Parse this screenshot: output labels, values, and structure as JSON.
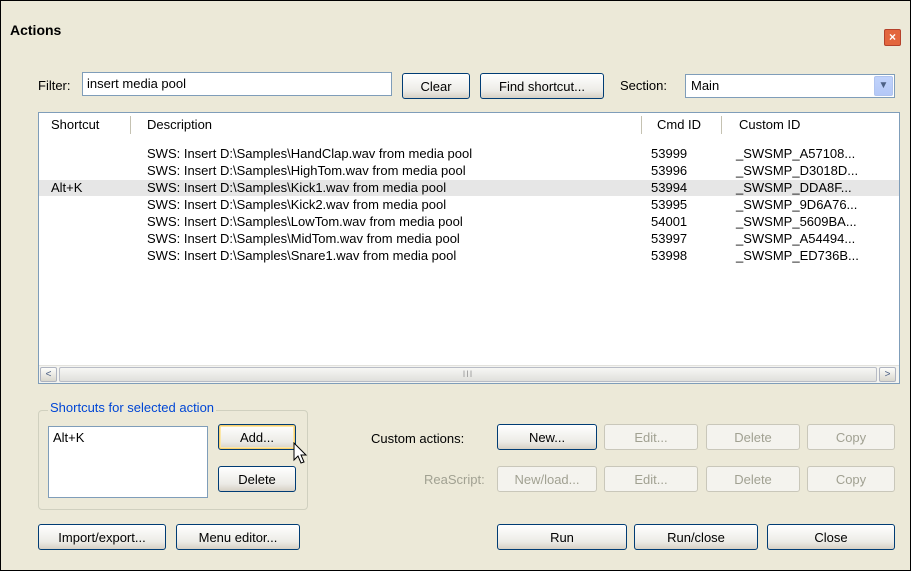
{
  "window": {
    "title": "Actions",
    "close_glyph": "×"
  },
  "filter": {
    "label": "Filter:",
    "value": "insert media pool",
    "clear_label": "Clear",
    "find_shortcut_label": "Find shortcut..."
  },
  "section": {
    "label": "Section:",
    "value": "Main"
  },
  "table": {
    "columns": [
      "Shortcut",
      "Description",
      "Cmd ID",
      "Custom ID"
    ],
    "rows": [
      {
        "shortcut": "",
        "description": "SWS: Insert D:\\Samples\\HandClap.wav from media pool",
        "cmd_id": "53999",
        "custom_id": "_SWSMP_A57108..."
      },
      {
        "shortcut": "",
        "description": "SWS: Insert D:\\Samples\\HighTom.wav from media pool",
        "cmd_id": "53996",
        "custom_id": "_SWSMP_D3018D..."
      },
      {
        "shortcut": "Alt+K",
        "description": "SWS: Insert D:\\Samples\\Kick1.wav from media pool",
        "cmd_id": "53994",
        "custom_id": "_SWSMP_DDA8F..."
      },
      {
        "shortcut": "",
        "description": "SWS: Insert D:\\Samples\\Kick2.wav from media pool",
        "cmd_id": "53995",
        "custom_id": "_SWSMP_9D6A76..."
      },
      {
        "shortcut": "",
        "description": "SWS: Insert D:\\Samples\\LowTom.wav from media pool",
        "cmd_id": "54001",
        "custom_id": "_SWSMP_5609BA..."
      },
      {
        "shortcut": "",
        "description": "SWS: Insert D:\\Samples\\MidTom.wav from media pool",
        "cmd_id": "53997",
        "custom_id": "_SWSMP_A54494..."
      },
      {
        "shortcut": "",
        "description": "SWS: Insert D:\\Samples\\Snare1.wav from media pool",
        "cmd_id": "53998",
        "custom_id": "_SWSMP_ED736B..."
      }
    ],
    "selected_row": 2,
    "scroll_left_glyph": "<",
    "scroll_right_glyph": ">",
    "scroll_thumb_glyph": "III"
  },
  "shortcuts": {
    "legend": "Shortcuts for selected action",
    "list_value": "Alt+K",
    "add_label": "Add...",
    "delete_label": "Delete"
  },
  "custom_actions": {
    "label": "Custom actions:",
    "new_label": "New...",
    "edit_label": "Edit...",
    "delete_label": "Delete",
    "copy_label": "Copy"
  },
  "reascript": {
    "label": "ReaScript:",
    "new_label": "New/load...",
    "edit_label": "Edit...",
    "delete_label": "Delete",
    "copy_label": "Copy"
  },
  "footer": {
    "import_export_label": "Import/export...",
    "menu_editor_label": "Menu editor...",
    "run_label": "Run",
    "run_close_label": "Run/close",
    "close_label": "Close"
  },
  "colors": {
    "window_bg": "#ece9d8",
    "close_button": "#e3663e",
    "group_legend": "#0046d5",
    "selected_row": "#e6e6e6"
  }
}
